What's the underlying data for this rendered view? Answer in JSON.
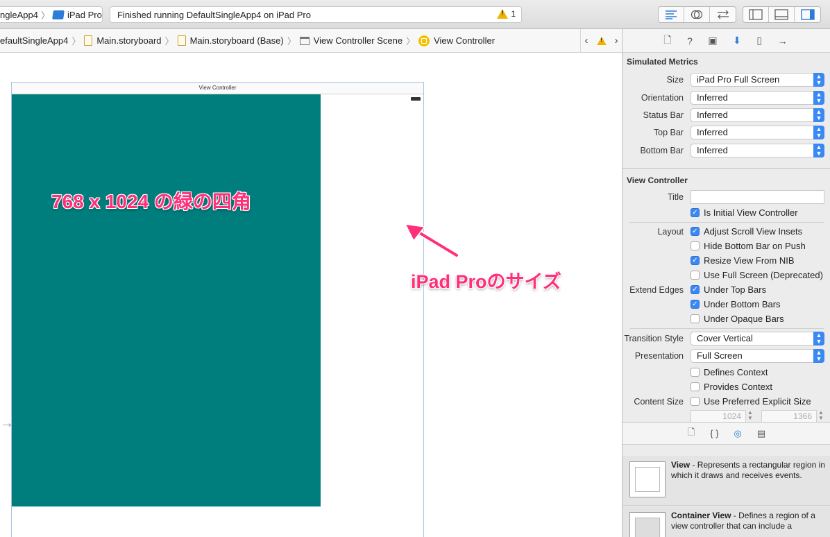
{
  "toolbar": {
    "scheme_name": "ngleApp4",
    "scheme_sep": "〉",
    "device": "iPad Pro",
    "status_text": "Finished running DefaultSingleApp4 on iPad Pro",
    "warning_count": "1"
  },
  "jumpbar": {
    "crumbs": [
      "efaultSingleApp4",
      "Main.storyboard",
      "Main.storyboard (Base)",
      "View Controller Scene",
      "View Controller"
    ]
  },
  "canvas": {
    "scene_title": "View Controller",
    "annotation_green": "768 x 1024 の緑の四角",
    "annotation_size": "iPad Proのサイズ",
    "green_color": "#007e7e",
    "annotation_color": "#ff2f7a"
  },
  "inspector": {
    "simulated_metrics_title": "Simulated Metrics",
    "size_label": "Size",
    "size_value": "iPad Pro Full Screen",
    "orientation_label": "Orientation",
    "orientation_value": "Inferred",
    "status_bar_label": "Status Bar",
    "status_bar_value": "Inferred",
    "top_bar_label": "Top Bar",
    "top_bar_value": "Inferred",
    "bottom_bar_label": "Bottom Bar",
    "bottom_bar_value": "Inferred",
    "vc_title": "View Controller",
    "title_label": "Title",
    "title_value": "",
    "initial_vc": "Is Initial View Controller",
    "layout_label": "Layout",
    "adjust_scroll": "Adjust Scroll View Insets",
    "hide_bottom": "Hide Bottom Bar on Push",
    "resize_nib": "Resize View From NIB",
    "full_screen": "Use Full Screen (Deprecated)",
    "extend_edges_label": "Extend Edges",
    "under_top": "Under Top Bars",
    "under_bottom": "Under Bottom Bars",
    "under_opaque": "Under Opaque Bars",
    "transition_label": "Transition Style",
    "transition_value": "Cover Vertical",
    "presentation_label": "Presentation",
    "presentation_value": "Full Screen",
    "defines_context": "Defines Context",
    "provides_context": "Provides Context",
    "content_size_label": "Content Size",
    "explicit_size": "Use Preferred Explicit Size",
    "width_value": "1024",
    "height_value": "1366"
  },
  "library": {
    "view_name": "View",
    "view_desc": " - Represents a rectangular region in which it draws and receives events.",
    "container_name": "Container View",
    "container_desc": " - Defines a region of a view controller that can include a"
  }
}
